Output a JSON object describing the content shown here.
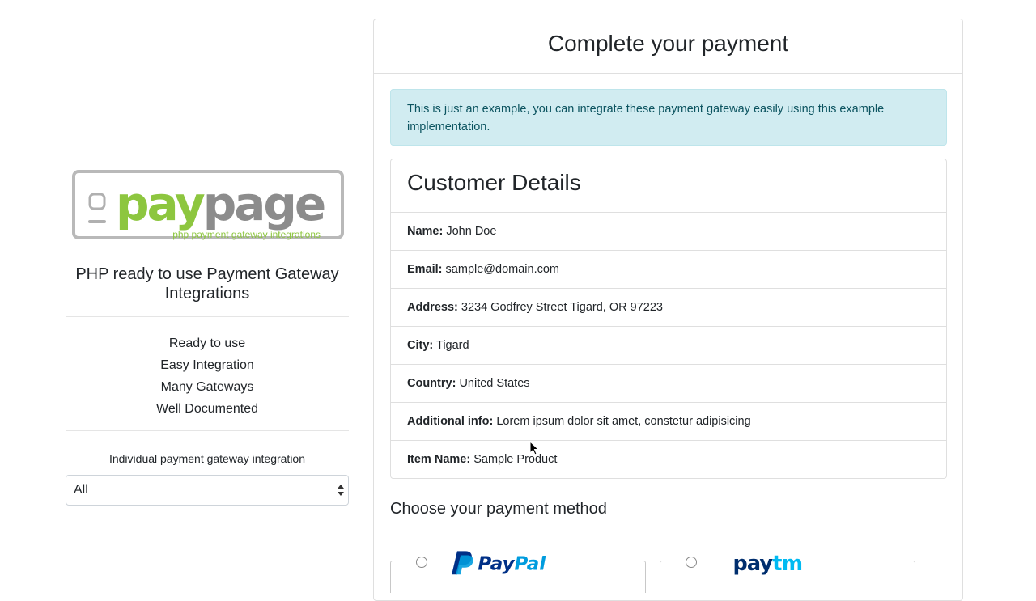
{
  "sidebar": {
    "logo_text": "paypage",
    "logo_subtitle": "php payment gateway integrations",
    "tagline": "PHP ready to use Payment Gateway Integrations",
    "features": [
      "Ready to use",
      "Easy Integration",
      "Many Gateways",
      "Well Documented"
    ],
    "gateway_label": "Individual payment gateway integration",
    "gateway_select_value": "All"
  },
  "main": {
    "title": "Complete your payment",
    "alert": "This is just an example, you can integrate these payment gateway easily using this example implementation.",
    "details": {
      "heading": "Customer Details",
      "rows": [
        {
          "label": "Name:",
          "value": "John Doe"
        },
        {
          "label": "Email:",
          "value": "sample@domain.com"
        },
        {
          "label": "Address:",
          "value": "3234 Godfrey Street Tigard, OR 97223"
        },
        {
          "label": "City:",
          "value": "Tigard"
        },
        {
          "label": "Country:",
          "value": "United States"
        },
        {
          "label": "Additional info:",
          "value": "Lorem ipsum dolor sit amet, constetur adipisicing"
        },
        {
          "label": "Item Name:",
          "value": "Sample Product"
        }
      ]
    },
    "payment_title": "Choose your payment method",
    "methods": [
      {
        "name": "PayPal"
      },
      {
        "name": "Paytm"
      }
    ]
  },
  "colors": {
    "logo_gray": "#8c8c8c",
    "logo_green": "#8dc63f",
    "alert_bg": "#d1ecf1",
    "alert_text": "#0c5460",
    "paypal_dark": "#003087",
    "paypal_light": "#009cde",
    "paytm_dark": "#002e6e",
    "paytm_light": "#00baf2"
  }
}
